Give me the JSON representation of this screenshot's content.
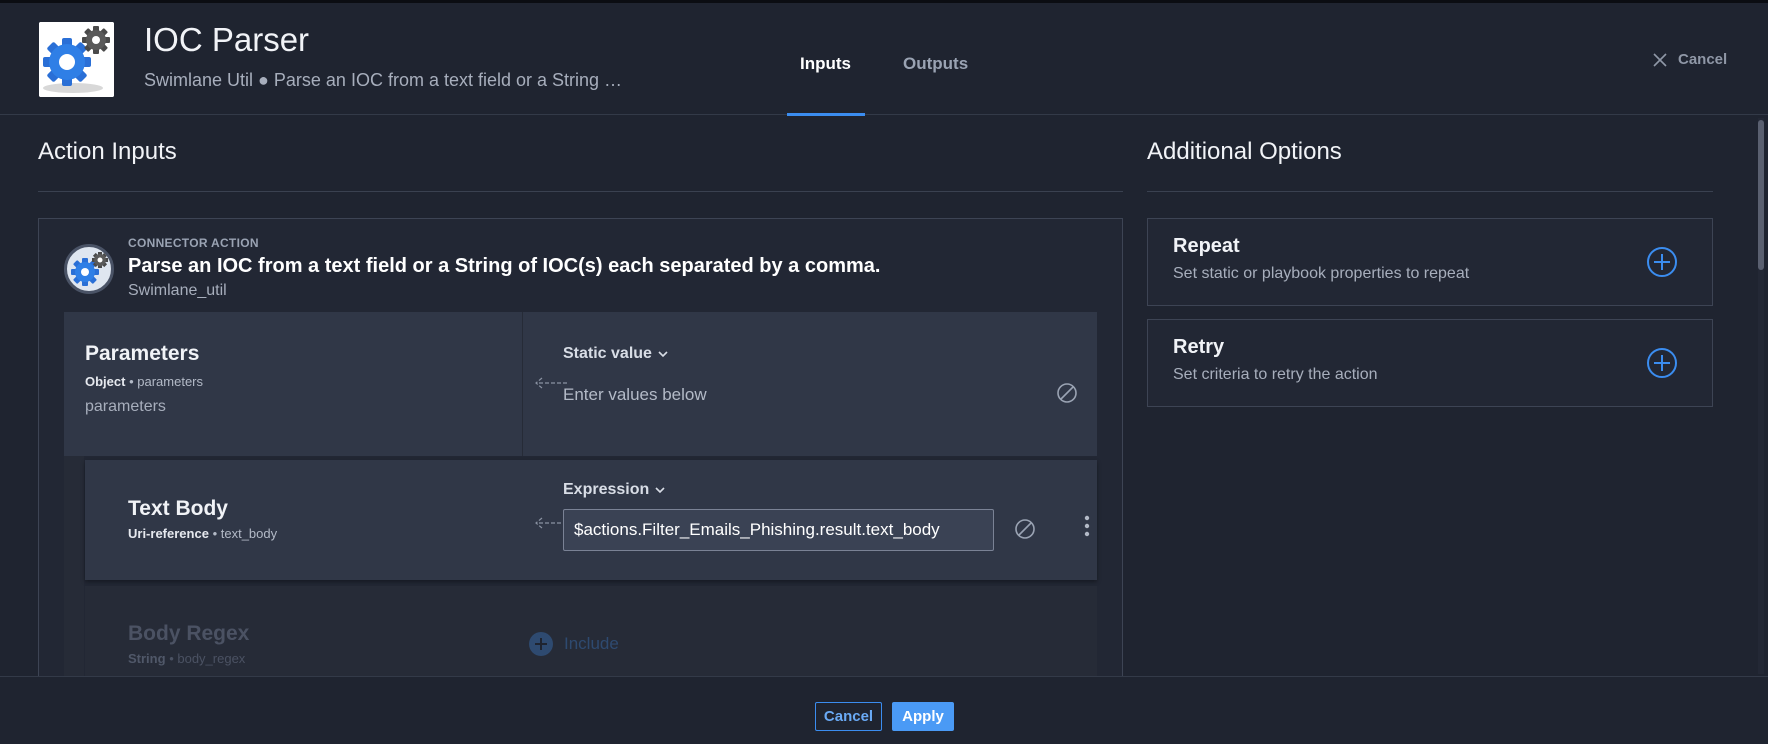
{
  "header": {
    "title": "IOC Parser",
    "subtitle": "Swimlane Util ● Parse an IOC from a text field or a String …",
    "tabs": [
      {
        "label": "Inputs",
        "active": true
      },
      {
        "label": "Outputs",
        "active": false
      }
    ],
    "cancel_label": "Cancel"
  },
  "left": {
    "section_title": "Action Inputs",
    "connector": {
      "label": "CONNECTOR ACTION",
      "title": "Parse an IOC from a text field or a String of IOC(s) each separated by a comma.",
      "subtitle": "Swimlane_util"
    },
    "parameters": {
      "title": "Parameters",
      "type": "Object",
      "key": "parameters",
      "description": "parameters",
      "mode": "Static value",
      "placeholder": "Enter values below"
    },
    "text_body": {
      "title": "Text Body",
      "type": "Uri-reference",
      "key": "text_body",
      "mode": "Expression",
      "value": "$actions.Filter_Emails_Phishing.result.text_body"
    },
    "body_regex": {
      "title": "Body Regex",
      "type": "String",
      "key": "body_regex",
      "include_label": "Include"
    }
  },
  "right": {
    "section_title": "Additional Options",
    "options": [
      {
        "title": "Repeat",
        "description": "Set static or playbook properties to repeat"
      },
      {
        "title": "Retry",
        "description": "Set criteria to retry the action"
      }
    ]
  },
  "footer": {
    "cancel_label": "Cancel",
    "apply_label": "Apply"
  },
  "colors": {
    "background": "#1f2430",
    "panel": "#303747",
    "accent": "#3b8df0"
  }
}
